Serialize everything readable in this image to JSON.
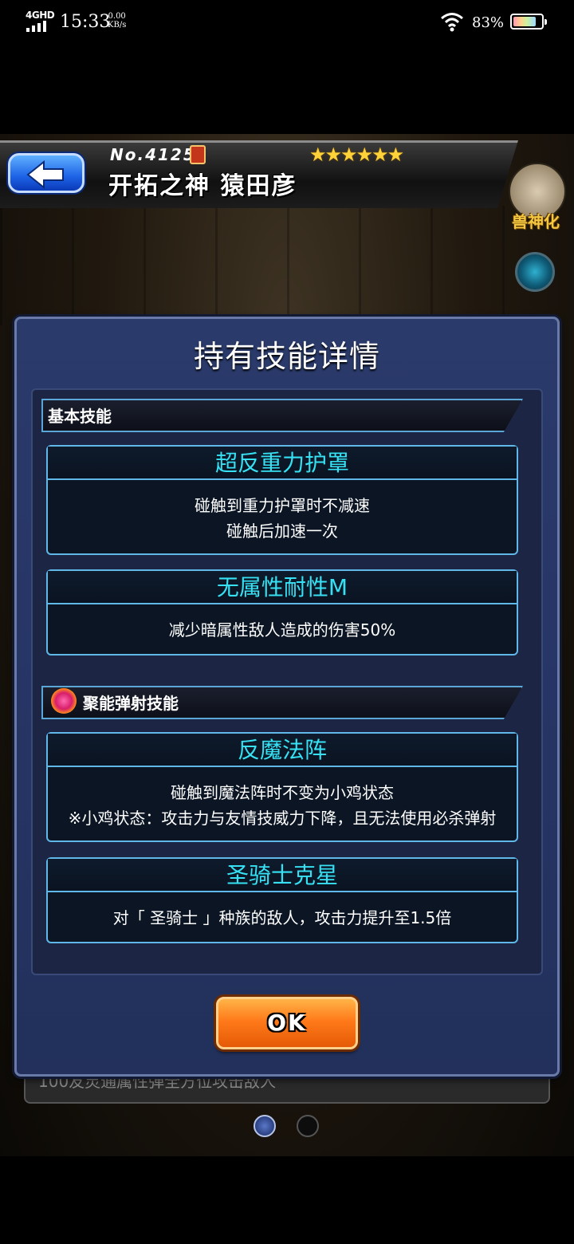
{
  "status_bar": {
    "network": "4GHD",
    "time": "15:33",
    "speed_value": "0.00",
    "speed_unit": "KB/s",
    "battery_percent": "83%",
    "battery_level": 0.83
  },
  "header": {
    "unit_number": "No.4125",
    "unit_name": "开拓之神 猿田彦",
    "stars": "★★★★★★",
    "evolve_label": "兽神化"
  },
  "dialog": {
    "title": "持有技能详情",
    "basic_section_title": "基本技能",
    "basic_skills": [
      {
        "name": "超反重力护罩",
        "lines": [
          "碰触到重力护罩时不减速",
          "碰触后加速一次"
        ]
      },
      {
        "name": "无属性耐性M",
        "lines": [
          "减少暗属性敌人造成的伤害50%"
        ]
      }
    ],
    "connect_section_title": "聚能弹射技能",
    "connect_skills": [
      {
        "name": "反魔法阵",
        "lines": [
          "碰触到魔法阵时不变为小鸡状态",
          "※小鸡状态：攻击力与友情技威力下降，且无法使用必杀弹射"
        ]
      },
      {
        "name": "圣骑士克星",
        "lines": [
          "对「 圣骑士 」种族的敌人，攻击力提升至1.5倍"
        ]
      }
    ],
    "ok_label": "OK"
  },
  "background_text": "100友灵通属性弹全方位攻击敌人",
  "pager": {
    "pages": 2,
    "current": 1
  },
  "colors": {
    "skill_name": "#35e1f3",
    "dialog_bg": "#263565",
    "ok_button": "#ff7a1a",
    "card_border": "#5fb8e8"
  }
}
